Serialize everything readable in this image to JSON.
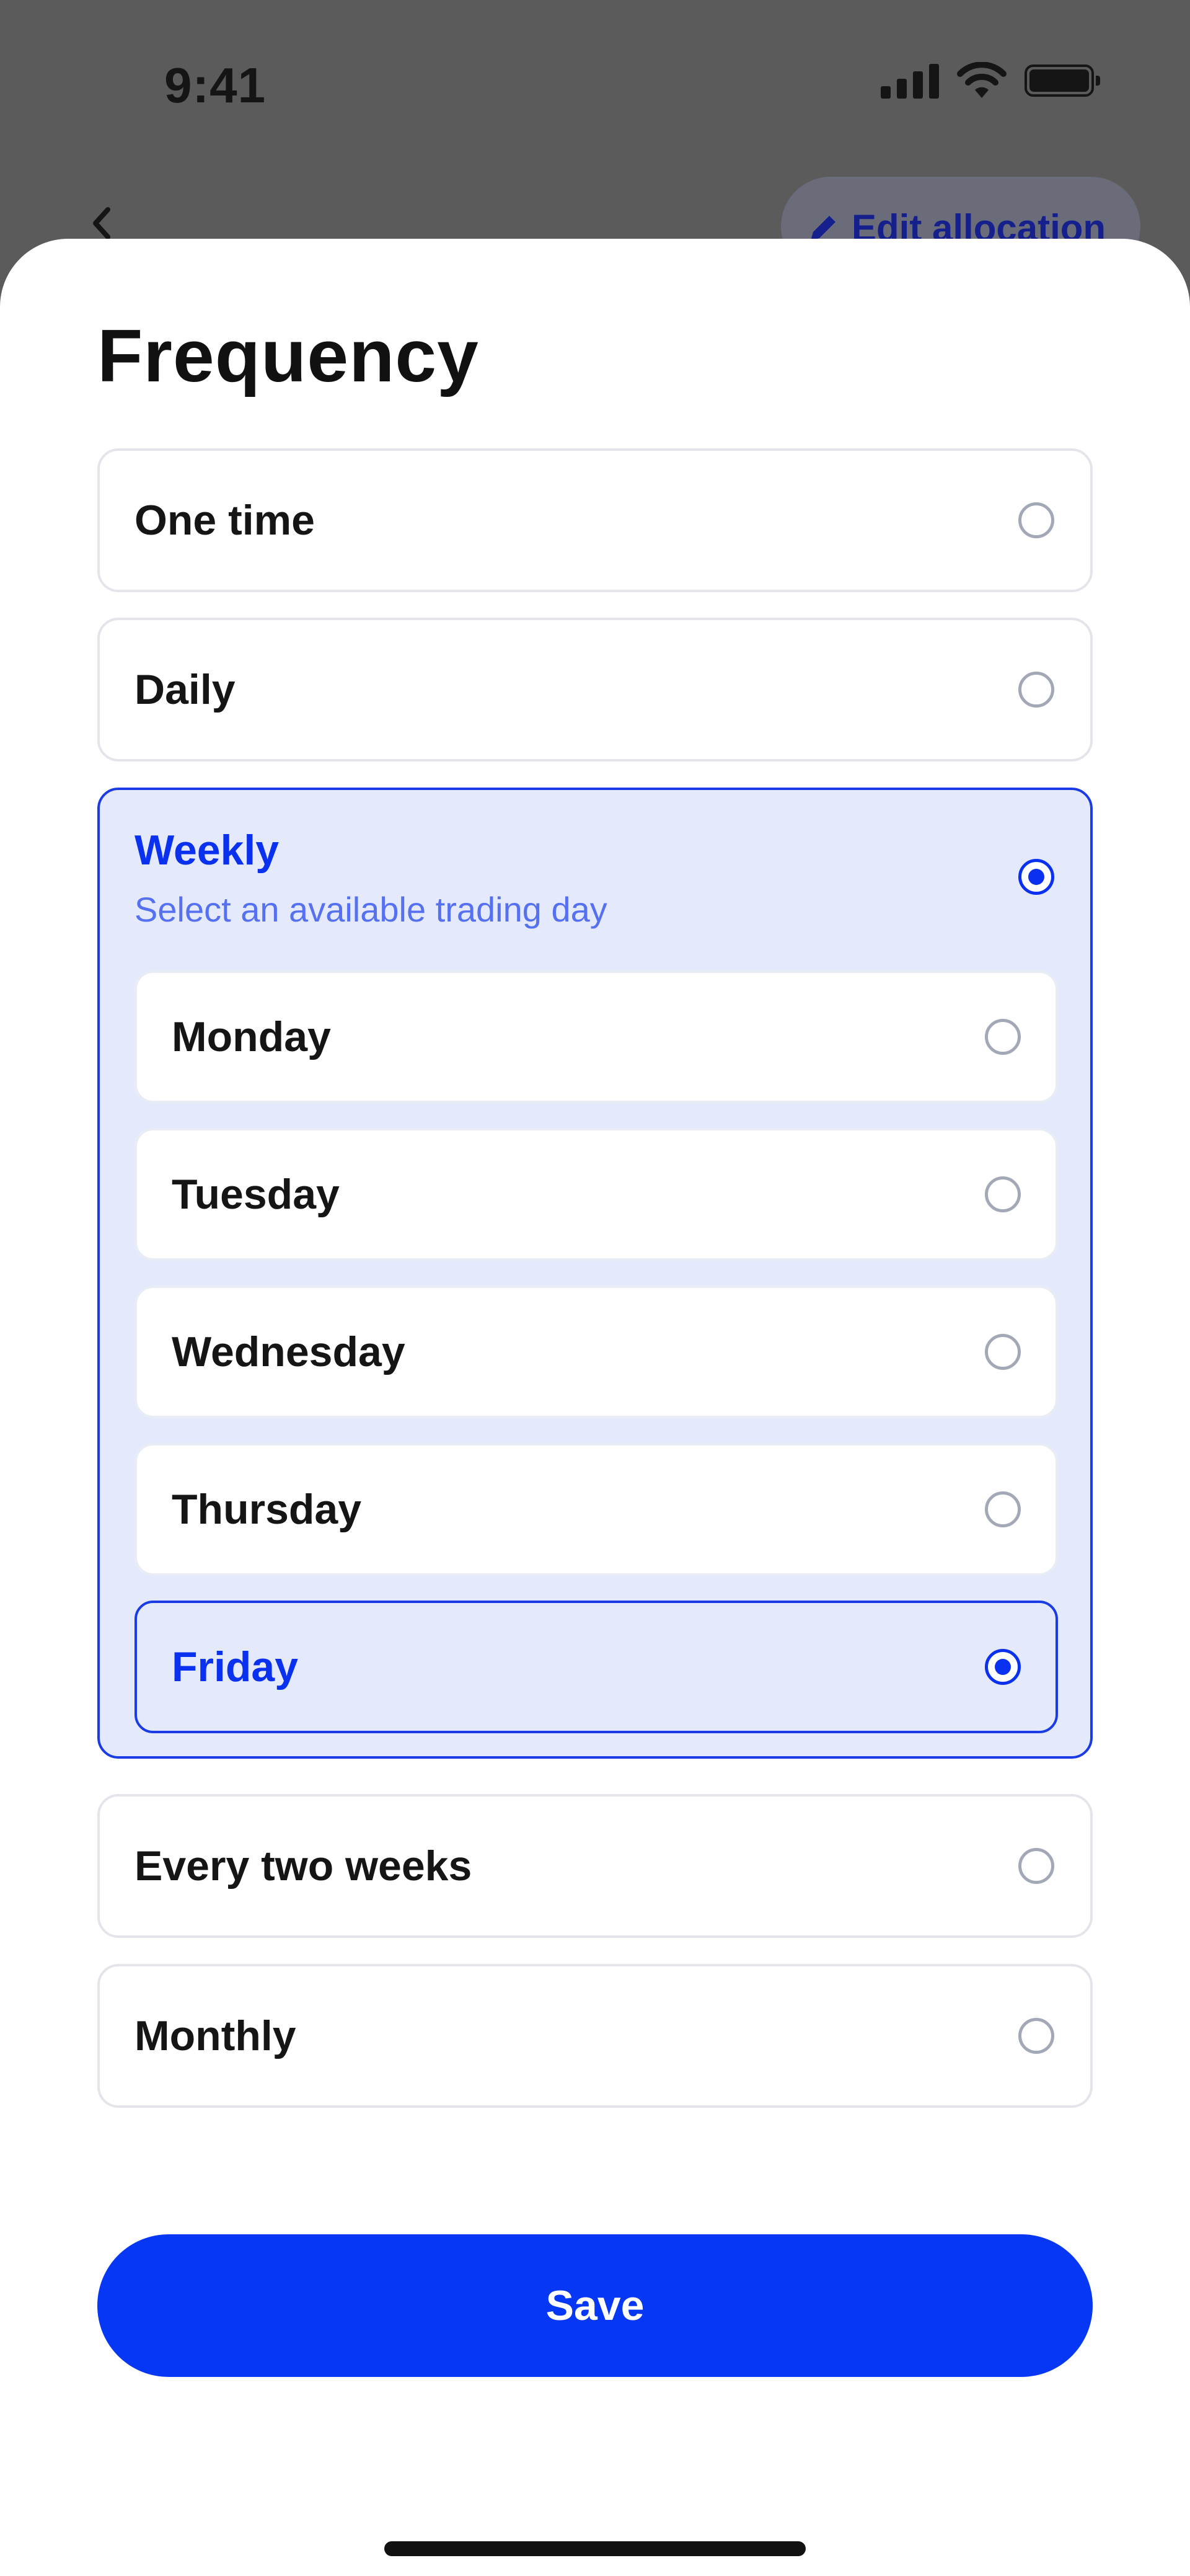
{
  "status_bar": {
    "time": "9:41",
    "icons": [
      "cellular-signal-icon",
      "wifi-icon",
      "battery-icon"
    ]
  },
  "nav": {
    "back_icon": "chevron-left-icon",
    "edit_label": "Edit allocation",
    "edit_icon": "pencil-icon"
  },
  "sheet": {
    "title": "Frequency",
    "options": [
      {
        "label": "One time",
        "selected": false
      },
      {
        "label": "Daily",
        "selected": false
      },
      {
        "label": "Weekly",
        "selected": true
      },
      {
        "label": "Every two weeks",
        "selected": false
      },
      {
        "label": "Monthly",
        "selected": false
      }
    ],
    "weekly": {
      "label": "Weekly",
      "subtitle": "Select an available trading day",
      "days": [
        {
          "label": "Monday",
          "selected": false
        },
        {
          "label": "Tuesday",
          "selected": false
        },
        {
          "label": "Wednesday",
          "selected": false
        },
        {
          "label": "Thursday",
          "selected": false
        },
        {
          "label": "Friday",
          "selected": true
        }
      ]
    },
    "save_label": "Save"
  },
  "colors": {
    "accent": "#0637F5",
    "selected_bg": "#E4EAFB",
    "border": "#E3E5EA",
    "overlay": "#5B5B5B"
  }
}
